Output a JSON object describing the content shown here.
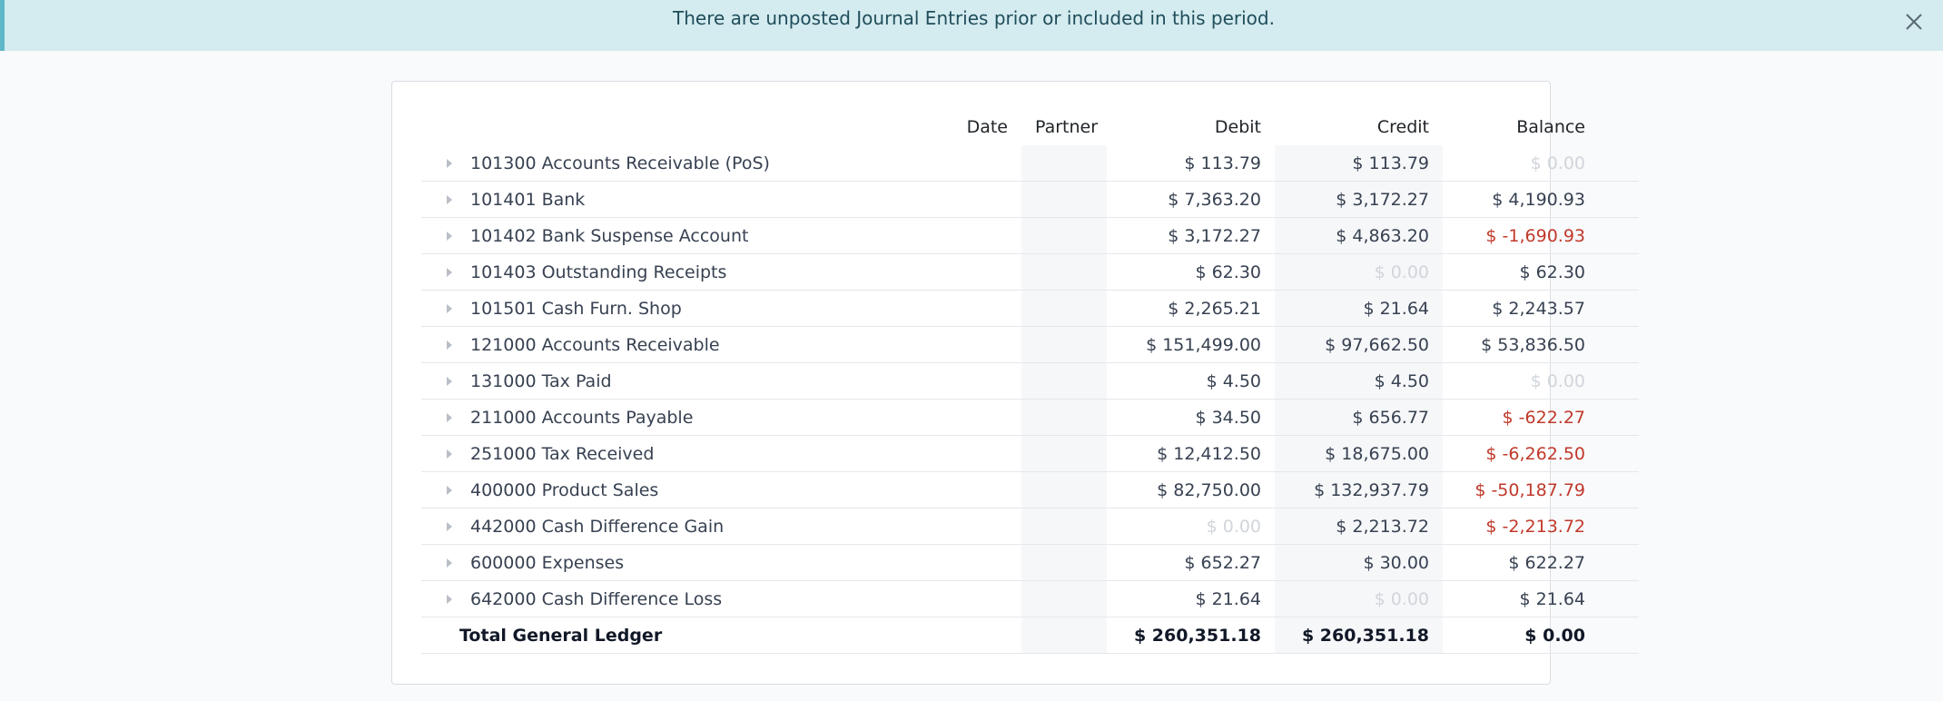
{
  "alert": {
    "message": "There are unposted Journal Entries prior or included in this period."
  },
  "table": {
    "headers": {
      "date": "Date",
      "partner": "Partner",
      "debit": "Debit",
      "credit": "Credit",
      "balance": "Balance"
    },
    "rows": [
      {
        "account": "101300 Accounts Receivable (PoS)",
        "debit": "$ 113.79",
        "credit": "$ 113.79",
        "balance": "$ 0.00"
      },
      {
        "account": "101401 Bank",
        "debit": "$ 7,363.20",
        "credit": "$ 3,172.27",
        "balance": "$ 4,190.93"
      },
      {
        "account": "101402 Bank Suspense Account",
        "debit": "$ 3,172.27",
        "credit": "$ 4,863.20",
        "balance": "$ -1,690.93"
      },
      {
        "account": "101403 Outstanding Receipts",
        "debit": "$ 62.30",
        "credit": "$ 0.00",
        "balance": "$ 62.30"
      },
      {
        "account": "101501 Cash Furn. Shop",
        "debit": "$ 2,265.21",
        "credit": "$ 21.64",
        "balance": "$ 2,243.57"
      },
      {
        "account": "121000 Accounts Receivable",
        "debit": "$ 151,499.00",
        "credit": "$ 97,662.50",
        "balance": "$ 53,836.50"
      },
      {
        "account": "131000 Tax Paid",
        "debit": "$ 4.50",
        "credit": "$ 4.50",
        "balance": "$ 0.00"
      },
      {
        "account": "211000 Accounts Payable",
        "debit": "$ 34.50",
        "credit": "$ 656.77",
        "balance": "$ -622.27"
      },
      {
        "account": "251000 Tax Received",
        "debit": "$ 12,412.50",
        "credit": "$ 18,675.00",
        "balance": "$ -6,262.50"
      },
      {
        "account": "400000 Product Sales",
        "debit": "$ 82,750.00",
        "credit": "$ 132,937.79",
        "balance": "$ -50,187.79"
      },
      {
        "account": "442000 Cash Difference Gain",
        "debit": "$ 0.00",
        "credit": "$ 2,213.72",
        "balance": "$ -2,213.72"
      },
      {
        "account": "600000 Expenses",
        "debit": "$ 652.27",
        "credit": "$ 30.00",
        "balance": "$ 622.27"
      },
      {
        "account": "642000 Cash Difference Loss",
        "debit": "$ 21.64",
        "credit": "$ 0.00",
        "balance": "$ 21.64"
      }
    ],
    "total": {
      "label": "Total General Ledger",
      "debit": "$ 260,351.18",
      "credit": "$ 260,351.18",
      "balance": "$ 0.00"
    }
  },
  "colors": {
    "alert_bg": "#d4ebf0",
    "alert_border": "#5fb8c8",
    "negative": "#c0392b",
    "zero": "#d1d5db"
  },
  "icons": {
    "close": "close-icon",
    "expand": "caret-right-icon"
  }
}
